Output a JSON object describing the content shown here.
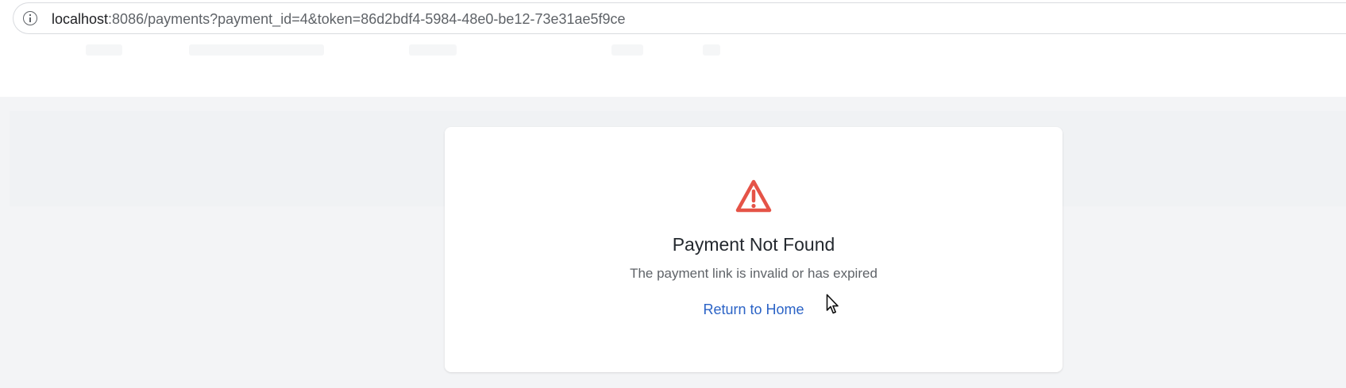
{
  "browser": {
    "url_host": "localhost",
    "url_rest": ":8086/payments?payment_id=4&token=86d2bdf4-5984-48e0-be12-73e31ae5f9ce"
  },
  "card": {
    "icon": "warning-triangle-icon",
    "title": "Payment Not Found",
    "message": "The payment link is invalid or has expired",
    "link_label": "Return to Home"
  },
  "colors": {
    "warning": "#e55347",
    "link": "#2b63c6",
    "page_background": "#f3f4f6",
    "card_background": "#ffffff"
  }
}
